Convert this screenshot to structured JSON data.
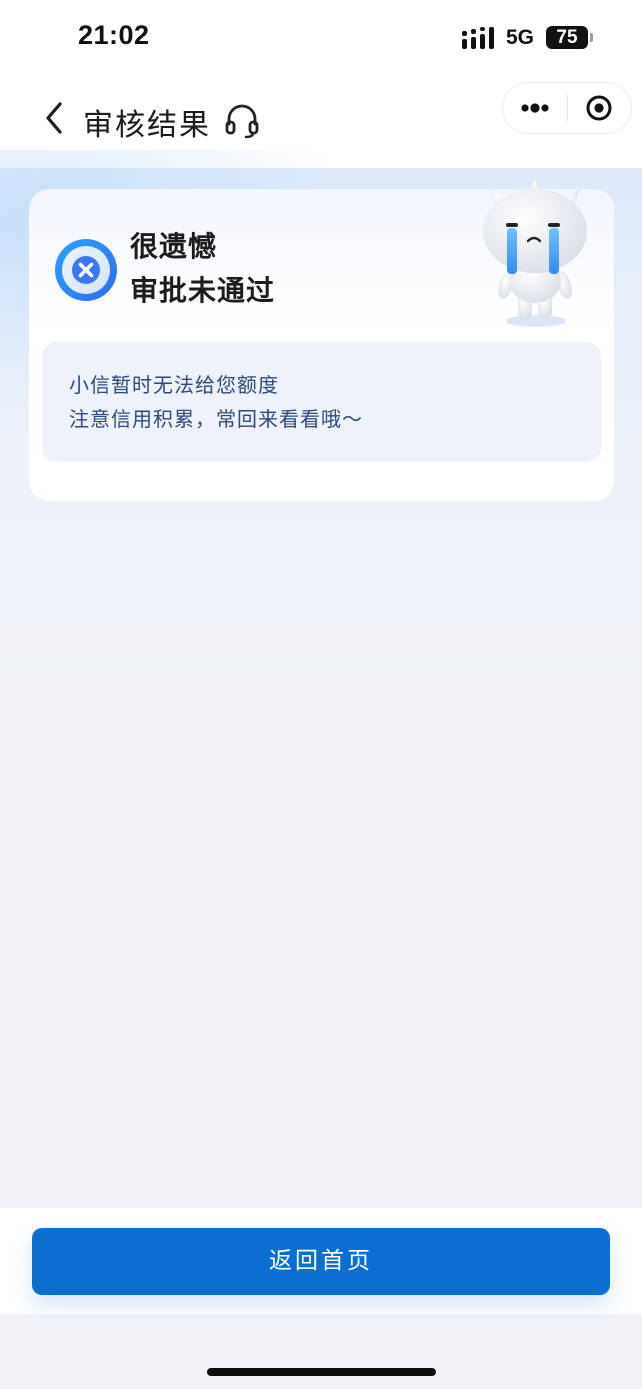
{
  "status_bar": {
    "time": "21:02",
    "network": "5G",
    "battery": "75"
  },
  "nav": {
    "title": "审核结果",
    "back_icon": "chevron-left-icon",
    "support_icon": "headset-icon",
    "more_icon": "more-dots-icon",
    "close_icon": "target-close-icon"
  },
  "result": {
    "status_icon": "x-circle-icon",
    "line1": "很遗憾",
    "line2": "审批未通过",
    "mascot": "crying-mascot",
    "message_line1": "小信暂时无法给您额度",
    "message_line2": "注意信用积累，常回来看看哦～"
  },
  "footer": {
    "home_button_label": "返回首页"
  },
  "colors": {
    "primary": "#0b6fd2",
    "message_text": "#2d4a7a",
    "page_bg": "#f1f3f8"
  }
}
